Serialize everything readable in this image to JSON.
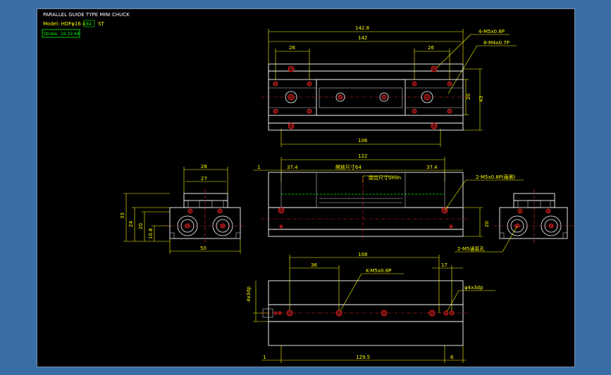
{
  "header": {
    "title": "PARALLEL GUIDE TYPE MINI CHUCK",
    "model_prefix": "Model: HDFφ16 x",
    "model_box": "84",
    "model_suffix": "ST",
    "stroke_label": "Stroke",
    "stroke_value": "16,32,64"
  },
  "top_view": {
    "dim_overall": "142.8",
    "dim_body": "142",
    "dim_left": "26",
    "dim_right": "26",
    "dim_pitch": "106",
    "dim_height_inner": "20",
    "dim_height_outer": "43",
    "note_a": "4-M5x0.8P",
    "note_b": "8-M4x0.7P"
  },
  "front_view": {
    "dim_offset": "1",
    "dim_width": "122",
    "dim_left": "37.4",
    "dim_right": "37.4",
    "open_label": "開放尺寸64",
    "close_label": "閉合尺寸0mm",
    "dim_height": "20",
    "note_ports": "2-M5x0.8P(兩側)",
    "note_bottom": "2-M5通氣孔"
  },
  "side_view": {
    "dim_top": "28",
    "dim_jaw": "27",
    "dim_height": "33",
    "dim_mid": "24",
    "dim_inner": "20",
    "dim_base": "10.8",
    "dim_width": "50"
  },
  "bottom_view": {
    "dim_pitch": "108",
    "dim_left": "36",
    "dim_right": "17",
    "note_k": "K-M5x0.8P",
    "note_dowel": "φ4x3dp",
    "dim_side": "4x3dp",
    "dim_off_left": "1",
    "dim_length": "129.5",
    "dim_off_right": "6"
  },
  "colors": {
    "background": "#000000",
    "frame": "#3a6ea5",
    "dimension": "#ffff00",
    "outline": "#ffffff",
    "hole": "#ff2020",
    "centerline": "#00ff00"
  }
}
